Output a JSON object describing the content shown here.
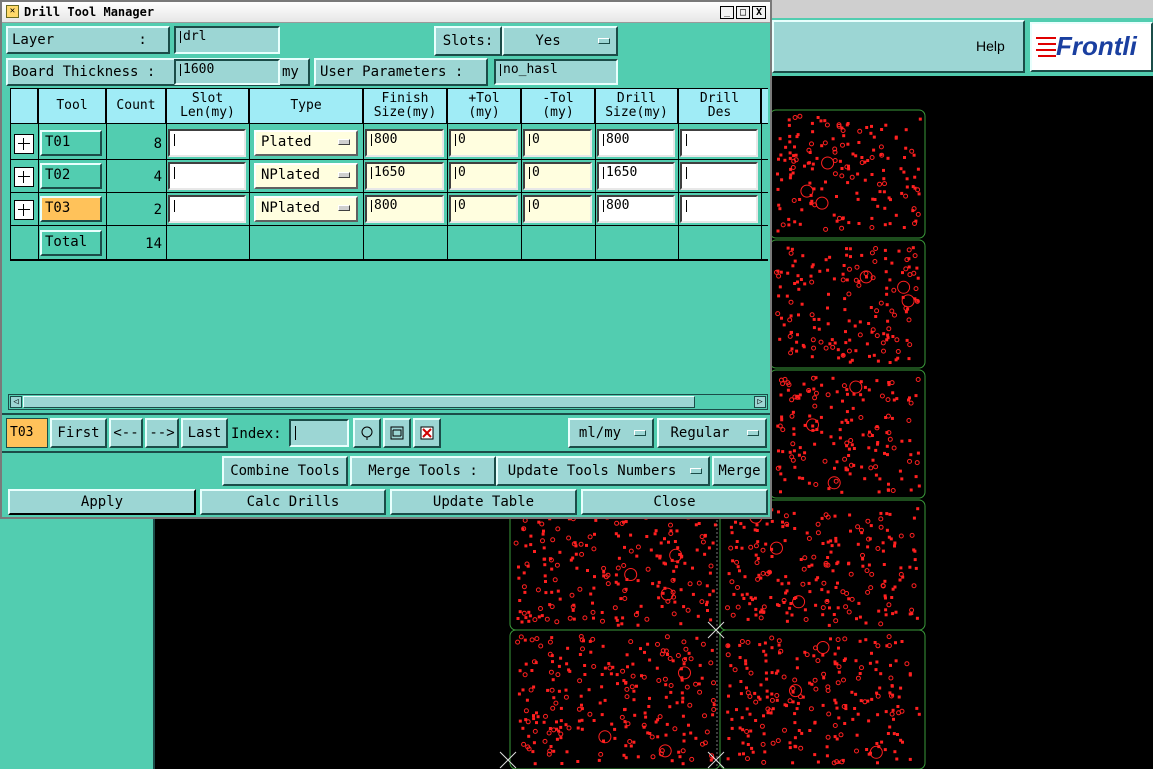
{
  "app": {
    "help_label": "Help",
    "logo_text": "Frontli"
  },
  "window": {
    "title": "Drill Tool Manager",
    "controls": [
      "_",
      "□",
      "X"
    ]
  },
  "top": {
    "layer_label": "Layer          :",
    "layer_value": "drl",
    "slots_label": "Slots:",
    "slots_value": "Yes",
    "board_thickness_label": "Board Thickness :",
    "board_thickness_value": "1600",
    "board_thickness_unit": "my",
    "user_params_label": "User Parameters :",
    "user_params_value": "no_hasl"
  },
  "table": {
    "headers": {
      "tool": "Tool",
      "count": "Count",
      "slot_len_1": "Slot",
      "slot_len_2": "Len(my)",
      "type": "Type",
      "finish_1": "Finish",
      "finish_2": "Size(my)",
      "ptol_1": "+Tol",
      "ptol_2": "(my)",
      "mtol_1": "-Tol",
      "mtol_2": "(my)",
      "drill_1": "Drill",
      "drill_2": "Size(my)",
      "des_1": "Drill",
      "des_2": "Des"
    },
    "rows": [
      {
        "tool": "T01",
        "count": "8",
        "type": "Plated",
        "finish": "800",
        "ptol": "0",
        "mtol": "0",
        "drill": "800"
      },
      {
        "tool": "T02",
        "count": "4",
        "type": "NPlated",
        "finish": "1650",
        "ptol": "0",
        "mtol": "0",
        "drill": "1650"
      },
      {
        "tool": "T03",
        "count": "2",
        "type": "NPlated",
        "finish": "800",
        "ptol": "0",
        "mtol": "0",
        "drill": "800"
      }
    ],
    "total_label": "Total",
    "total_count": "14"
  },
  "nav": {
    "current": "T03",
    "first": "First",
    "prev": "<--",
    "next": "-->",
    "last": "Last",
    "index_label": "Index:",
    "units": "ml/my",
    "mode": "Regular"
  },
  "actions": {
    "combine": "Combine Tools",
    "merge_label": "Merge Tools :",
    "update_numbers": "Update Tools Numbers",
    "merge": "Merge",
    "apply": "Apply",
    "calc": "Calc Drills",
    "update_table": "Update Table",
    "close": "Close"
  },
  "colors": {
    "panel": "#52cdb0",
    "header": "#a0ecf6",
    "selected_tool": "#ffc25a",
    "pad": "#ff2020",
    "outline": "#3a9a3a"
  }
}
